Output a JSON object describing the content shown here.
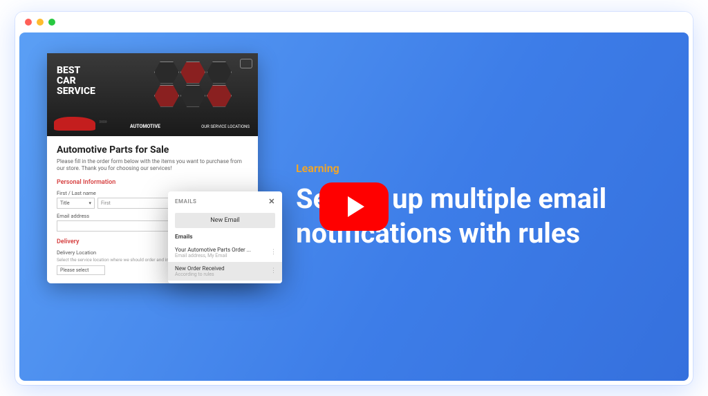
{
  "form": {
    "banner": {
      "title_line1": "BEST",
      "title_line2": "CAR",
      "title_line3": "SERVICE",
      "automotive": "AUTOMOTIVE",
      "locations_label": "OUR SERVICE LOCATIONS"
    },
    "title": "Automotive Parts for Sale",
    "description": "Please fill in the order form below with the items you want to purchase from our store. Thank you for choosing our services!",
    "personal_info": "Personal Information",
    "first_last_label": "First / Last name",
    "title_select": "Title",
    "first_placeholder": "First",
    "email_label": "Email address",
    "delivery": "Delivery",
    "delivery_location": "Delivery Location",
    "delivery_desc": "Select the service location where we should order and install the parts",
    "please_select": "Please select"
  },
  "emails": {
    "header": "EMAILS",
    "new_button": "New Email",
    "section": "Emails",
    "items": [
      {
        "title": "Your Automotive Parts Order ...",
        "sub": "Email address, My Email"
      },
      {
        "title": "New Order Received",
        "sub": "According to rules"
      }
    ]
  },
  "video": {
    "category": "Learning",
    "heading": "Setting up multiple email notifications with rules"
  }
}
